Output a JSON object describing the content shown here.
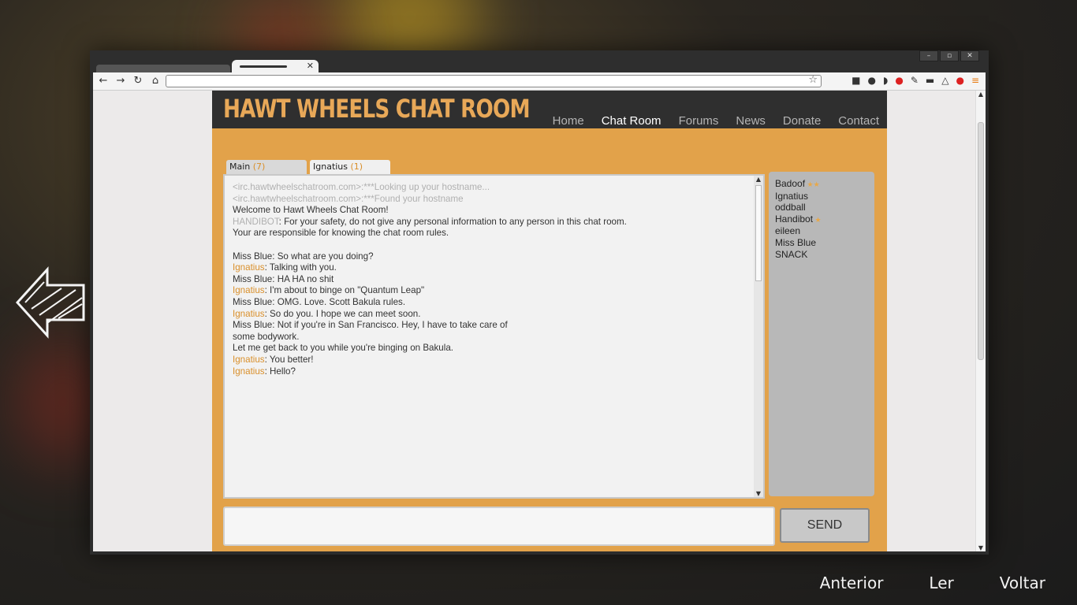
{
  "site": {
    "title": "HAWT WHEELS CHAT ROOM",
    "menu": [
      "Home",
      "Chat Room",
      "Forums",
      "News",
      "Donate",
      "Contact"
    ],
    "active_menu_index": 1
  },
  "chat_tabs": [
    {
      "name": "Main",
      "count": "(7)",
      "active": false
    },
    {
      "name": "Ignatius",
      "count": "(1)",
      "active": true
    }
  ],
  "chat_log": [
    {
      "speaker": "",
      "text": "<irc.hawtwheelschatroom.com>:***Looking up your hostname...",
      "style": "system"
    },
    {
      "speaker": "",
      "text": "<irc.hawtwheelschatroom.com>:***Found your hostname",
      "style": "system"
    },
    {
      "speaker": "",
      "text": "Welcome to Hawt Wheels Chat Room!",
      "style": "normal"
    },
    {
      "speaker": "HANDIBOT",
      "text": ": For your safety, do not give any personal information to any person in this chat room.",
      "style": "bot"
    },
    {
      "speaker": "",
      "text": "Your are responsible for knowing the chat room rules.",
      "style": "normal"
    },
    {
      "speaker": "",
      "text": " ",
      "style": "normal"
    },
    {
      "speaker": "",
      "text": "Miss Blue: So what are you doing?",
      "style": "normal"
    },
    {
      "speaker": "Ignatius",
      "text": ": Talking with you.",
      "style": "me"
    },
    {
      "speaker": "",
      "text": "Miss Blue: HA HA no shit",
      "style": "normal"
    },
    {
      "speaker": "Ignatius",
      "text": ": I'm about to binge on \"Quantum Leap\"",
      "style": "me"
    },
    {
      "speaker": "",
      "text": "Miss Blue: OMG. Love. Scott Bakula rules.",
      "style": "normal"
    },
    {
      "speaker": "Ignatius",
      "text": ": So do you. I hope we can meet soon.",
      "style": "me"
    },
    {
      "speaker": "",
      "text": "Miss Blue: Not if you're in San Francisco. Hey, I have to take care of",
      "style": "normal"
    },
    {
      "speaker": "",
      "text": "some bodywork.",
      "style": "normal"
    },
    {
      "speaker": "",
      "text": "Let me get back to you while you're binging on Bakula.",
      "style": "normal"
    },
    {
      "speaker": "Ignatius",
      "text": ": You better!",
      "style": "me"
    },
    {
      "speaker": "Ignatius",
      "text": ": Hello?",
      "style": "me"
    }
  ],
  "users": [
    {
      "name": "Badoof",
      "stars": 2
    },
    {
      "name": "Ignatius",
      "stars": 0
    },
    {
      "name": "oddball",
      "stars": 0
    },
    {
      "name": "Handibot",
      "stars": 1
    },
    {
      "name": "eileen",
      "stars": 0
    },
    {
      "name": "Miss Blue",
      "stars": 0
    },
    {
      "name": "SNACK",
      "stars": 0
    }
  ],
  "compose": {
    "value": "",
    "send_label": "SEND"
  },
  "game_prompts": [
    "Anterior",
    "Ler",
    "Voltar"
  ],
  "colors": {
    "accent": "#e2a24a",
    "header": "#2f2f2f",
    "speaker_highlight": "#d98f2a"
  }
}
